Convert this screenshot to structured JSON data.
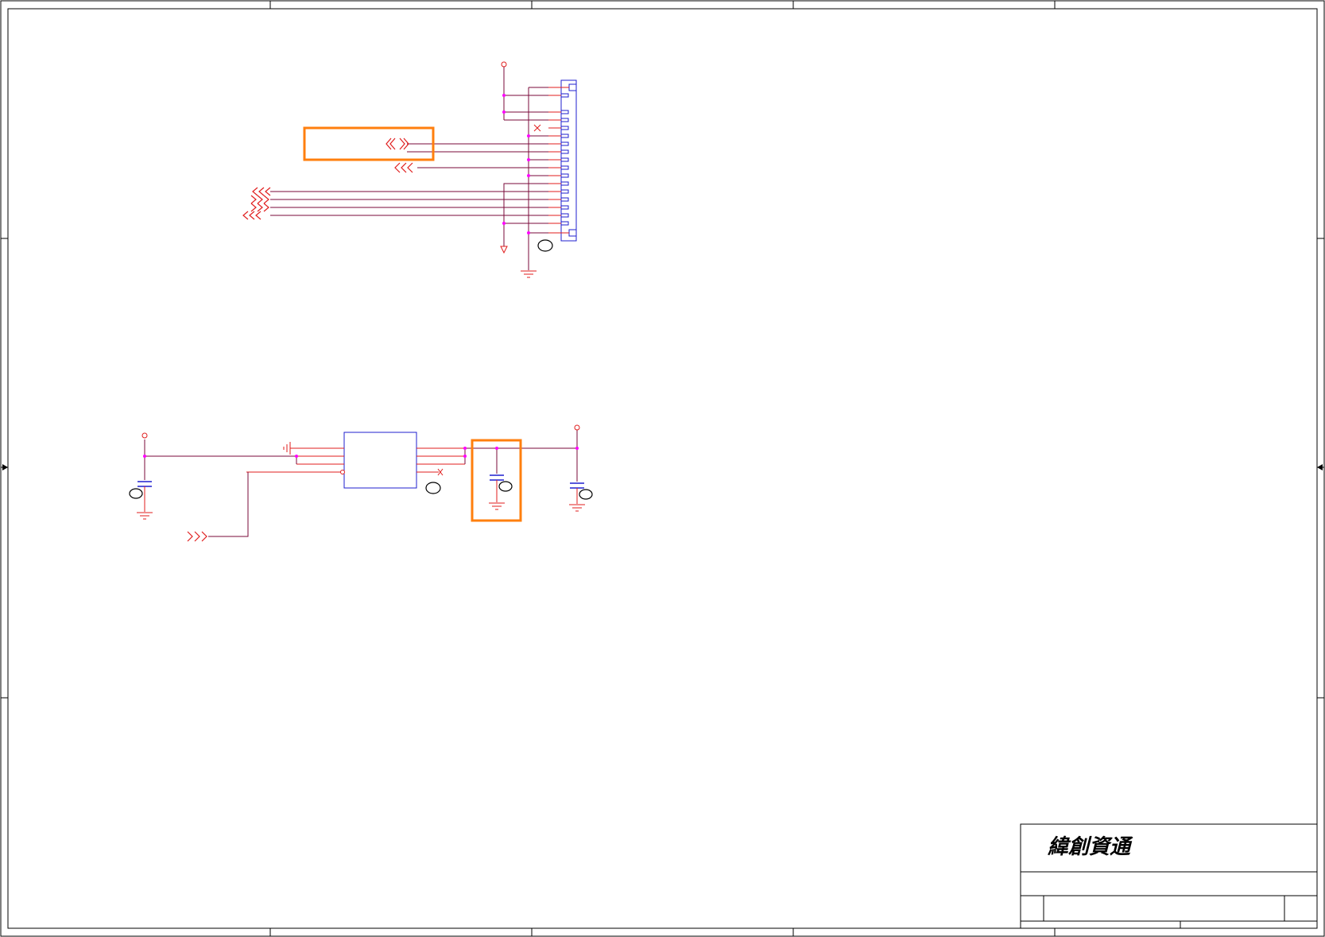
{
  "title_block": {
    "company_name": "緯創資通"
  },
  "colors": {
    "frame": "#000000",
    "wire": "#7a0a3a",
    "power": "#e01e1e",
    "junction": "#ff00ff",
    "component": "#1f1fcf",
    "highlight": "#ff7f0e"
  },
  "icons": [
    "power-flag-icon",
    "ground-icon",
    "capacitor-icon",
    "connector-icon",
    "offpage-arrow-icon",
    "no-connect-icon",
    "part-tag-icon"
  ]
}
